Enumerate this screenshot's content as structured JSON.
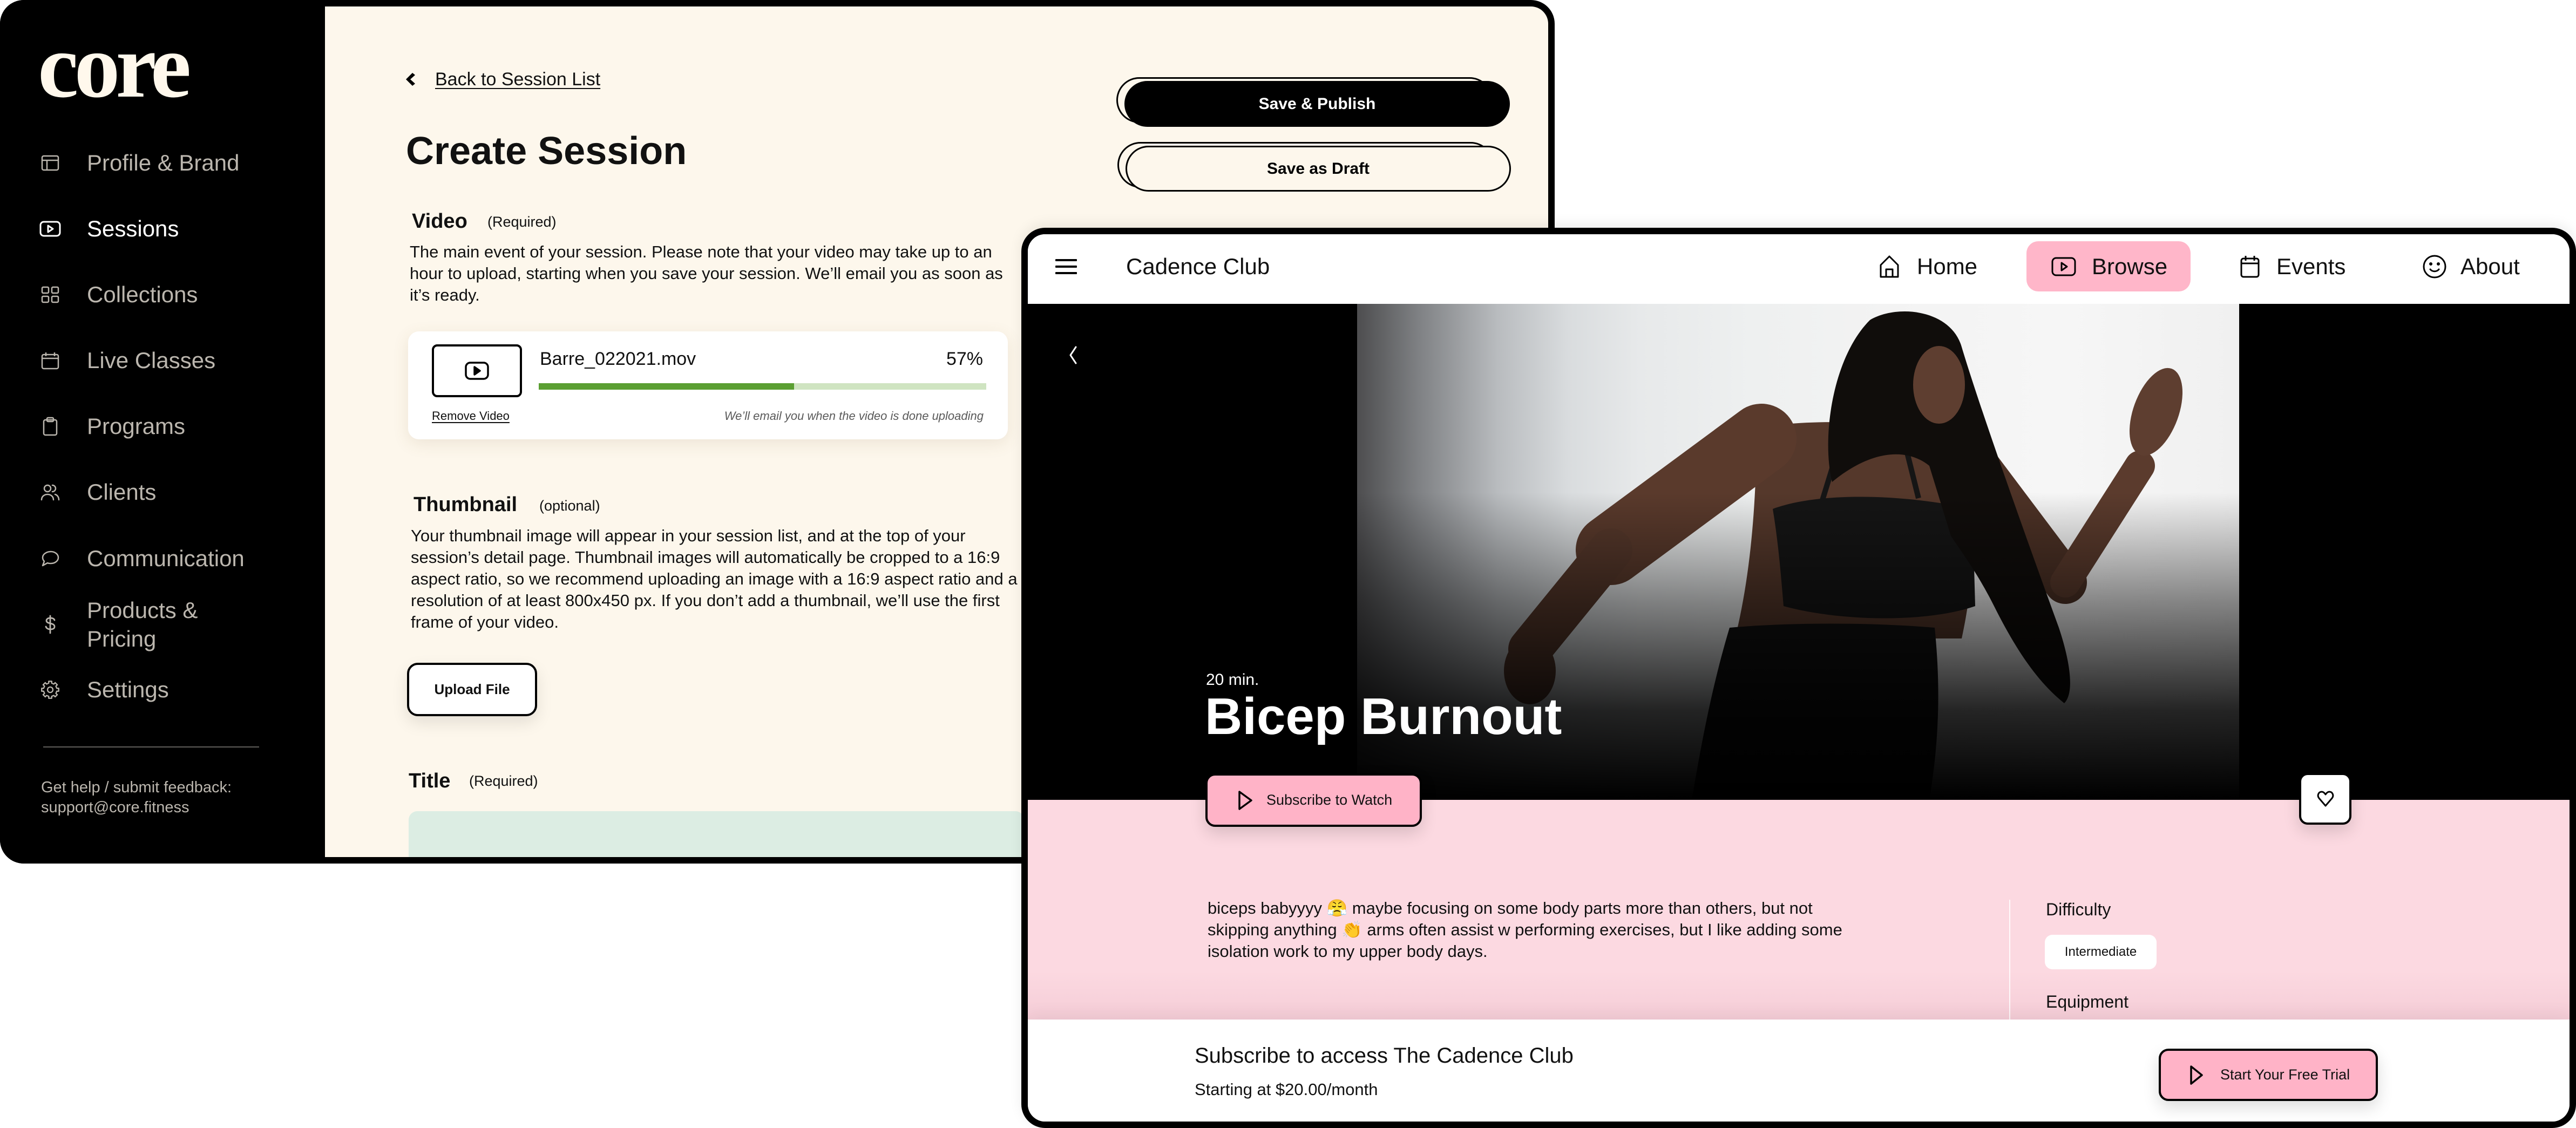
{
  "theme": {
    "cream": "#FDF7EC",
    "sidebar_text": "#BBB6AE",
    "logo": "#FFF8EC",
    "progress_fill": "#5B9F32",
    "progress_track": "#CFE4C1",
    "title_input_bg": "#DCEDE3",
    "accent_pink": "#FFB3C7",
    "section_pink": "#FCD9E1",
    "nav_active_pink": "#FFB6C9"
  },
  "left_app": {
    "logo": "core",
    "sidebar": {
      "items": [
        {
          "label": "Profile & Brand",
          "icon": "layout-icon",
          "active": false
        },
        {
          "label": "Sessions",
          "icon": "video-icon",
          "active": true
        },
        {
          "label": "Collections",
          "icon": "grid-icon",
          "active": false
        },
        {
          "label": "Live Classes",
          "icon": "calendar-icon",
          "active": false
        },
        {
          "label": "Programs",
          "icon": "clipboard-icon",
          "active": false
        },
        {
          "label": "Clients",
          "icon": "users-icon",
          "active": false
        },
        {
          "label": "Communication",
          "icon": "chat-icon",
          "active": false
        },
        {
          "label": "Products & Pricing",
          "icon": "dollar-icon",
          "active": false
        },
        {
          "label": "Settings",
          "icon": "gear-icon",
          "active": false
        }
      ],
      "footer": {
        "line1": "Get help / submit feedback:",
        "line2": "support@core.fitness"
      }
    },
    "main": {
      "back_link": "Back to Session List",
      "page_title": "Create Session",
      "actions": {
        "publish": "Save & Publish",
        "draft": "Save as Draft"
      },
      "video": {
        "label": "Video",
        "qualifier": "(Required)",
        "description": "The main event of your session. Please note that your video may take up to an hour to upload, starting when you save your session. We’ll email you as soon as it’s ready.",
        "upload": {
          "filename": "Barre_022021.mov",
          "progress_percent": 57,
          "progress_label": "57%",
          "remove_label": "Remove Video",
          "note": "We’ll email you when the video is done uploading"
        }
      },
      "thumbnail": {
        "label": "Thumbnail",
        "qualifier": "(optional)",
        "description": "Your thumbnail image will appear in your session list, and at the top of your session’s detail page. Thumbnail images will automatically be cropped to a 16:9 aspect ratio, so we recommend uploading an image with a 16:9 aspect ratio and a resolution of at least 800x450 px. If you don’t add a thumbnail, we’ll use the first frame of your video.",
        "upload_button": "Upload File"
      },
      "title_field": {
        "label": "Title",
        "qualifier": "(Required)",
        "value": ""
      }
    }
  },
  "right_app": {
    "brand": "Cadence Club",
    "nav": [
      {
        "label": "Home",
        "icon": "home-icon",
        "active": false
      },
      {
        "label": "Browse",
        "icon": "video-icon",
        "active": true
      },
      {
        "label": "Events",
        "icon": "calendar-icon",
        "active": false
      },
      {
        "label": "About",
        "icon": "smiley-icon",
        "active": false
      }
    ],
    "session": {
      "duration": "20 min.",
      "title": "Bicep Burnout",
      "cta": "Subscribe to Watch",
      "description": "biceps babyyyy 😤 maybe focusing on some body parts more than others, but not skipping anything 👏 arms often assist w performing exercises, but I like adding some isolation work to my upper body days.",
      "details": {
        "difficulty_label": "Difficulty",
        "difficulty_value": "Intermediate",
        "equipment_label": "Equipment"
      }
    },
    "subscribe_bar": {
      "heading": "Subscribe to access The Cadence Club",
      "price": "Starting at $20.00/month",
      "cta": "Start Your Free Trial"
    }
  }
}
